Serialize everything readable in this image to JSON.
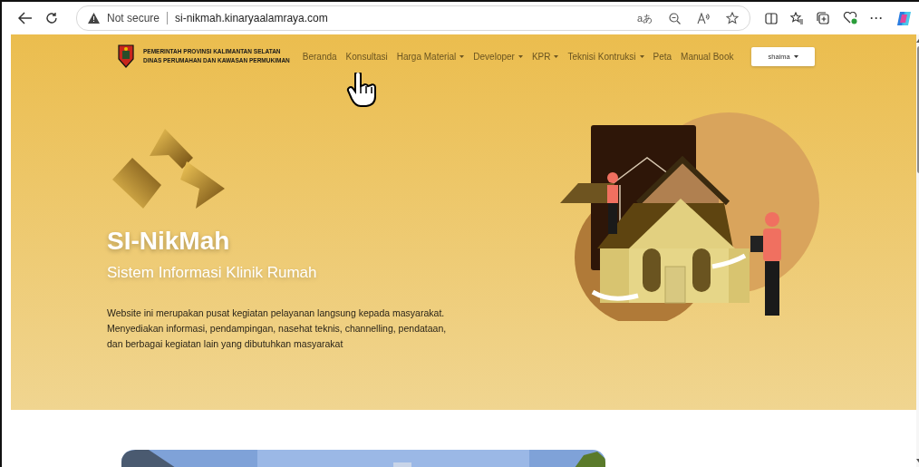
{
  "browser": {
    "security": "Not secure",
    "url": "si-nikmah.kinaryaalamraya.com",
    "translate_glyph": "aあ",
    "more_glyph": "···"
  },
  "header": {
    "org_lines": [
      "PEMERINTAH PROVINSI KALIMANTAN SELATAN",
      "DINAS PERUMAHAN DAN KAWASAN PERMUKIMAN"
    ],
    "nav": [
      {
        "label": "Beranda",
        "dropdown": false
      },
      {
        "label": "Konsultasi",
        "dropdown": false
      },
      {
        "label": "Harga Material",
        "dropdown": true
      },
      {
        "label": "Developer",
        "dropdown": true
      },
      {
        "label": "KPR",
        "dropdown": true
      },
      {
        "label": "Teknisi Kontruksi",
        "dropdown": true
      },
      {
        "label": "Peta",
        "dropdown": false
      },
      {
        "label": "Manual Book",
        "dropdown": false
      }
    ],
    "user": {
      "label": "shaima",
      "dropdown": true
    }
  },
  "hero": {
    "title": "SI-NikMah",
    "subtitle": "Sistem Informasi Klinik Rumah",
    "description": "Website ini merupakan pusat kegiatan pelayanan langsung kepada masyarakat. Menyediakan informasi, pendampingan, nasehat teknis, channelling, pendataan, dan berbagai kegiatan lain yang dibutuhkan masyarakat"
  }
}
